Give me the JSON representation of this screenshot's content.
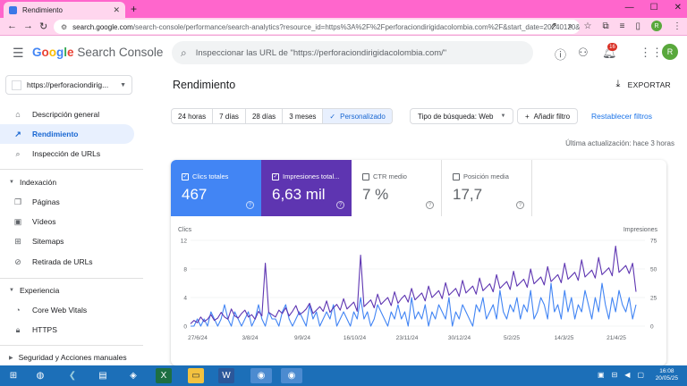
{
  "browser": {
    "tab_title": "Rendimiento",
    "url_host": "search.google.com",
    "url_rest": "/search-console/performance/search-analytics?resource_id=https%3A%2F%2Fperforaciondirigidacolombia.com%2F&start_date=20240120&en...",
    "avatar_letter": "R"
  },
  "header": {
    "product": "Search Console",
    "search_placeholder": "Inspeccionar las URL de \"https://perforaciondirigidacolombia.com/\"",
    "notifications_count": "16",
    "avatar_letter": "R"
  },
  "sidebar": {
    "property": "https://perforaciondirig...",
    "items": [
      {
        "label": "Descripción general",
        "icon": "home-icon"
      },
      {
        "label": "Rendimiento",
        "icon": "trending-up-icon"
      },
      {
        "label": "Inspección de URLs",
        "icon": "search-icon"
      }
    ],
    "sections": [
      {
        "label": "Indexación",
        "items": [
          {
            "label": "Páginas",
            "icon": "pages-icon"
          },
          {
            "label": "Vídeos",
            "icon": "video-icon"
          },
          {
            "label": "Sitemaps",
            "icon": "sitemap-icon"
          },
          {
            "label": "Retirada de URLs",
            "icon": "block-icon"
          }
        ]
      },
      {
        "label": "Experiencia",
        "items": [
          {
            "label": "Core Web Vitals",
            "icon": "speed-icon"
          },
          {
            "label": "HTTPS",
            "icon": "lock-icon"
          }
        ]
      },
      {
        "label": "Seguridad y Acciones manuales",
        "items": []
      }
    ]
  },
  "main": {
    "title": "Rendimiento",
    "export_label": "EXPORTAR",
    "date_filters": [
      "24 horas",
      "7 días",
      "28 días",
      "3 meses",
      "Personalizado"
    ],
    "selected_filter": "Personalizado",
    "search_type": "Tipo de búsqueda: Web",
    "add_filter": "Añadir filtro",
    "reset_filters": "Restablecer filtros",
    "last_updated": "Última actualización: hace 3 horas",
    "metrics": [
      {
        "label": "Clics totales",
        "value": "467",
        "checked": true
      },
      {
        "label": "Impresiones total...",
        "value": "6,63 mil",
        "checked": true
      },
      {
        "label": "CTR medio",
        "value": "7 %",
        "checked": false
      },
      {
        "label": "Posición media",
        "value": "17,7",
        "checked": false
      }
    ]
  },
  "chart_data": {
    "type": "line",
    "left_axis_label": "Clics",
    "right_axis_label": "Impresiones",
    "left_ticks": [
      "12",
      "8",
      "4",
      "0"
    ],
    "right_ticks": [
      "75",
      "50",
      "25",
      "0"
    ],
    "left_ylim": [
      0,
      12
    ],
    "right_ylim": [
      0,
      75
    ],
    "x_ticks": [
      "27/6/24",
      "3/8/24",
      "9/9/24",
      "16/10/24",
      "23/11/24",
      "30/12/24",
      "5/2/25",
      "14/3/25",
      "21/4/25"
    ],
    "series": [
      {
        "name": "Clics totales",
        "color": "#4285f4",
        "axis": "left",
        "values": [
          0,
          0,
          1,
          0,
          1,
          0,
          2,
          1,
          0,
          1,
          3,
          1,
          0,
          2,
          1,
          0,
          1,
          2,
          0,
          1,
          3,
          1,
          0,
          2,
          1,
          1,
          0,
          2,
          3,
          1,
          0,
          1,
          2,
          1,
          0,
          3,
          1,
          2,
          0,
          1,
          2,
          1,
          3,
          0,
          1,
          2,
          1,
          0,
          2,
          1,
          4,
          1,
          2,
          0,
          1,
          3,
          2,
          1,
          0,
          2,
          1,
          3,
          1,
          2,
          0,
          4,
          1,
          2,
          1,
          3,
          0,
          2,
          1,
          3,
          2,
          1,
          4,
          0,
          2,
          1,
          3,
          2,
          1,
          0,
          3,
          2,
          4,
          1,
          2,
          3,
          1,
          5,
          2,
          1,
          3,
          2,
          4,
          1,
          3,
          2,
          5,
          1,
          2,
          4,
          3,
          1,
          6,
          2,
          3,
          1,
          5,
          2,
          4,
          1,
          3,
          2,
          5,
          3,
          1,
          4,
          2,
          6,
          3,
          1,
          4,
          2,
          5,
          3,
          2,
          4,
          1,
          3
        ]
      },
      {
        "name": "Impresiones totales",
        "color": "#5e35b1",
        "axis": "right",
        "values": [
          2,
          5,
          3,
          8,
          4,
          6,
          10,
          5,
          7,
          12,
          8,
          6,
          15,
          9,
          7,
          11,
          14,
          8,
          10,
          6,
          13,
          9,
          55,
          12,
          10,
          8,
          14,
          11,
          16,
          9,
          13,
          18,
          10,
          12,
          15,
          20,
          11,
          14,
          17,
          13,
          22,
          12,
          16,
          19,
          14,
          24,
          15,
          18,
          21,
          13,
          62,
          17,
          20,
          23,
          16,
          28,
          19,
          22,
          25,
          18,
          30,
          20,
          24,
          27,
          21,
          33,
          23,
          26,
          29,
          22,
          35,
          25,
          28,
          31,
          24,
          38,
          27,
          30,
          33,
          26,
          40,
          29,
          32,
          35,
          28,
          42,
          31,
          34,
          37,
          30,
          45,
          33,
          36,
          39,
          32,
          48,
          35,
          38,
          41,
          34,
          50,
          37,
          40,
          43,
          36,
          52,
          39,
          42,
          45,
          38,
          55,
          41,
          44,
          47,
          40,
          58,
          43,
          46,
          49,
          42,
          60,
          45,
          48,
          51,
          44,
          70,
          47,
          50,
          53,
          46,
          55,
          30
        ]
      }
    ]
  },
  "taskbar": {
    "time": "16:08",
    "date": "20/05/25"
  }
}
